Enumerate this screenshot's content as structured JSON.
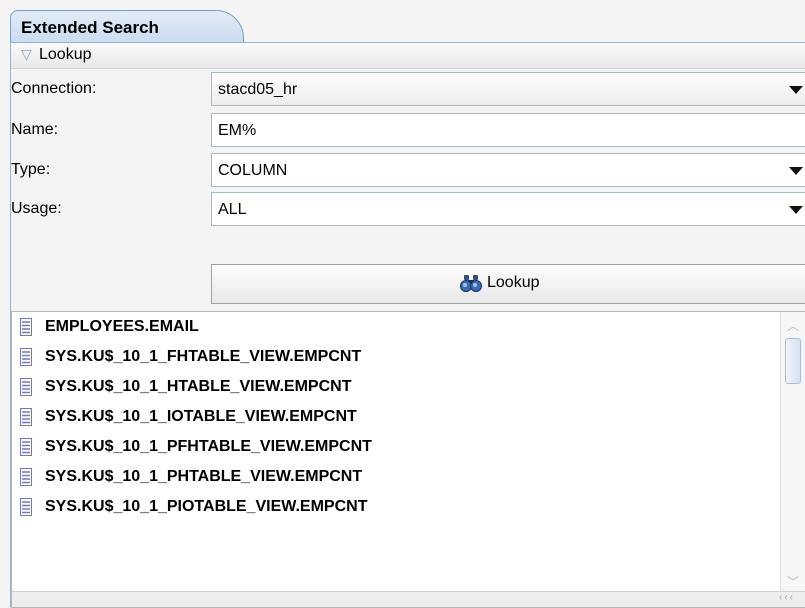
{
  "tab": {
    "title": "Extended Search"
  },
  "section": {
    "title": "Lookup"
  },
  "form": {
    "connection": {
      "label": "Connection:",
      "value": "stacd05_hr"
    },
    "name": {
      "label": "Name:",
      "value": "EM%"
    },
    "type": {
      "label": "Type:",
      "value": "COLUMN"
    },
    "usage": {
      "label": "Usage:",
      "value": "ALL"
    }
  },
  "lookup_button": {
    "label": "Lookup",
    "icon": "binoculars-icon"
  },
  "results": {
    "icon": "column-icon",
    "items": [
      "EMPLOYEES.EMAIL",
      "SYS.KU$_10_1_FHTABLE_VIEW.EMPCNT",
      "SYS.KU$_10_1_HTABLE_VIEW.EMPCNT",
      "SYS.KU$_10_1_IOTABLE_VIEW.EMPCNT",
      "SYS.KU$_10_1_PFHTABLE_VIEW.EMPCNT",
      "SYS.KU$_10_1_PHTABLE_VIEW.EMPCNT",
      "SYS.KU$_10_1_PIOTABLE_VIEW.EMPCNT"
    ]
  },
  "colors": {
    "tab_bg": "#c9dcf0",
    "border": "#a9b8c8",
    "icon": "#6f78b8"
  }
}
